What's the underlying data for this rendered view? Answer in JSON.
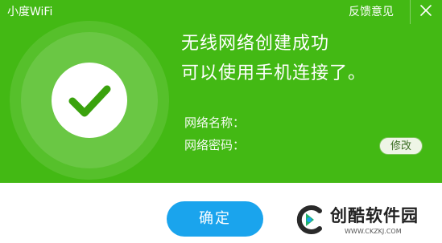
{
  "app": {
    "title": "小度WiFi",
    "feedback_label": "反馈意见"
  },
  "main": {
    "headline_line1": "无线网络创建成功",
    "headline_line2": "可以使用手机连接了。",
    "ssid_label": "网络名称：",
    "password_label": "网络密码：",
    "modify_label": "修改"
  },
  "footer": {
    "confirm_label": "确定"
  },
  "watermark": {
    "name": "创酷软件园",
    "url": "WWW.CKZKJ.COM"
  },
  "colors": {
    "panel_green": "#43b914",
    "confirm_blue": "#1aa4ed",
    "check_green": "#3aa20d"
  },
  "icons": {
    "close": "close-icon",
    "success": "checkmark-icon",
    "watermark_logo": "watermark-logo"
  }
}
